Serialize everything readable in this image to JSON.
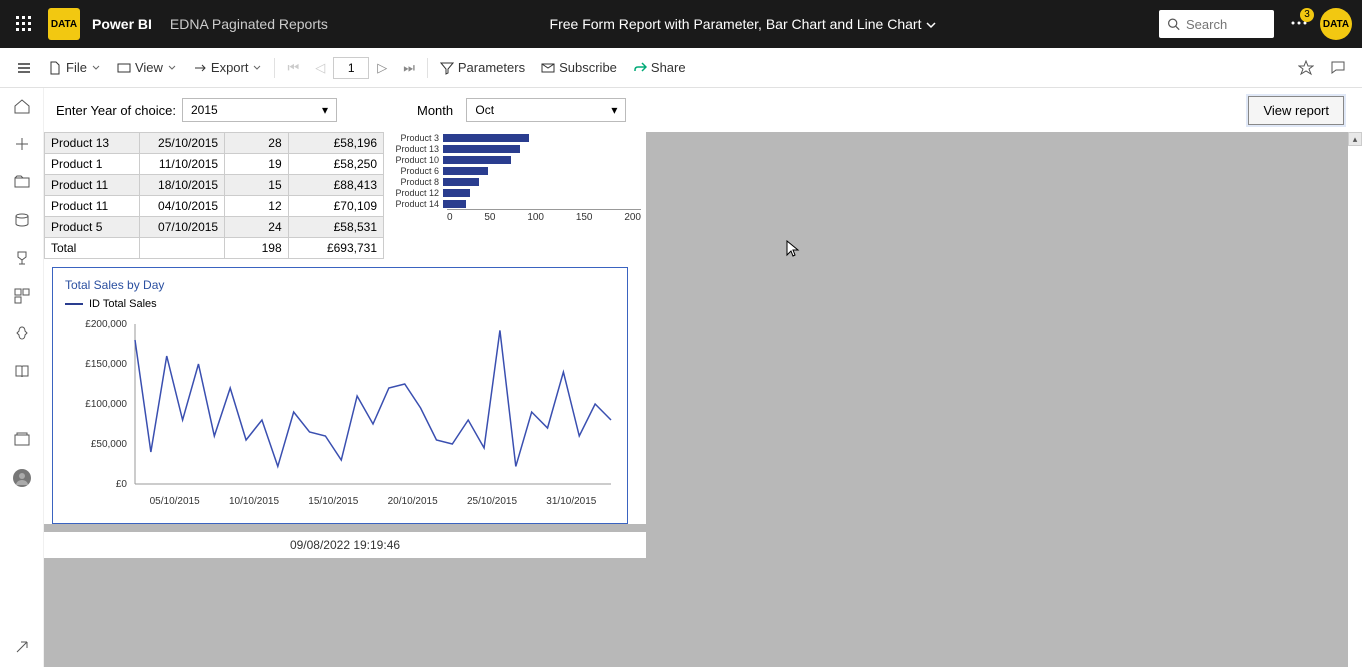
{
  "header": {
    "brand": "Power BI",
    "workspace": "EDNA Paginated Reports",
    "report_title": "Free Form Report with Parameter, Bar Chart and Line Chart",
    "search_placeholder": "Search",
    "notif_count": "3",
    "logo_text": "DATA",
    "avatar_text": "DATA"
  },
  "toolbar": {
    "file": "File",
    "view": "View",
    "export": "Export",
    "page": "1",
    "parameters": "Parameters",
    "subscribe": "Subscribe",
    "share": "Share"
  },
  "params": {
    "year_label": "Enter Year of choice:",
    "year_value": "2015",
    "month_label": "Month",
    "month_value": "Oct",
    "view_report": "View report"
  },
  "table_rows": [
    {
      "p": "Product 13",
      "d": "25/10/2015",
      "q": "28",
      "s": "£58,196"
    },
    {
      "p": "Product 1",
      "d": "11/10/2015",
      "q": "19",
      "s": "£58,250"
    },
    {
      "p": "Product 11",
      "d": "18/10/2015",
      "q": "15",
      "s": "£88,413"
    },
    {
      "p": "Product 11",
      "d": "04/10/2015",
      "q": "12",
      "s": "£70,109"
    },
    {
      "p": "Product 5",
      "d": "07/10/2015",
      "q": "24",
      "s": "£58,531"
    }
  ],
  "table_total": {
    "label": "Total",
    "q": "198",
    "s": "£693,731"
  },
  "chart_data": [
    {
      "type": "bar",
      "title": "",
      "orientation": "horizontal",
      "categories": [
        "Product 3",
        "Product 13",
        "Product 10",
        "Product 6",
        "Product 8",
        "Product 12",
        "Product 14"
      ],
      "values": [
        95,
        85,
        75,
        50,
        40,
        30,
        25
      ],
      "xlabel": "",
      "ylabel": "",
      "xlim": [
        0,
        200
      ],
      "xticks": [
        0,
        50,
        100,
        150,
        200
      ],
      "color": "#2a3d8f"
    },
    {
      "type": "line",
      "title": "Total Sales by Day",
      "series": [
        {
          "name": "ID Total Sales",
          "values": [
            180000,
            40000,
            160000,
            80000,
            150000,
            60000,
            120000,
            55000,
            80000,
            22000,
            90000,
            65000,
            60000,
            30000,
            110000,
            75000,
            120000,
            125000,
            95000,
            55000,
            50000,
            80000,
            45000,
            192000,
            22000,
            90000,
            70000,
            140000,
            60000,
            100000,
            80000
          ]
        }
      ],
      "x_labels": [
        "05/10/2015",
        "10/10/2015",
        "15/10/2015",
        "20/10/2015",
        "25/10/2015",
        "31/10/2015"
      ],
      "ylabel": "",
      "xlabel": "",
      "ylim": [
        0,
        200000
      ],
      "yticks": [
        "£0",
        "£50,000",
        "£100,000",
        "£150,000",
        "£200,000"
      ],
      "color": "#3a4fb0"
    }
  ],
  "line_legend": "ID Total Sales",
  "footer_timestamp": "09/08/2022 19:19:46"
}
